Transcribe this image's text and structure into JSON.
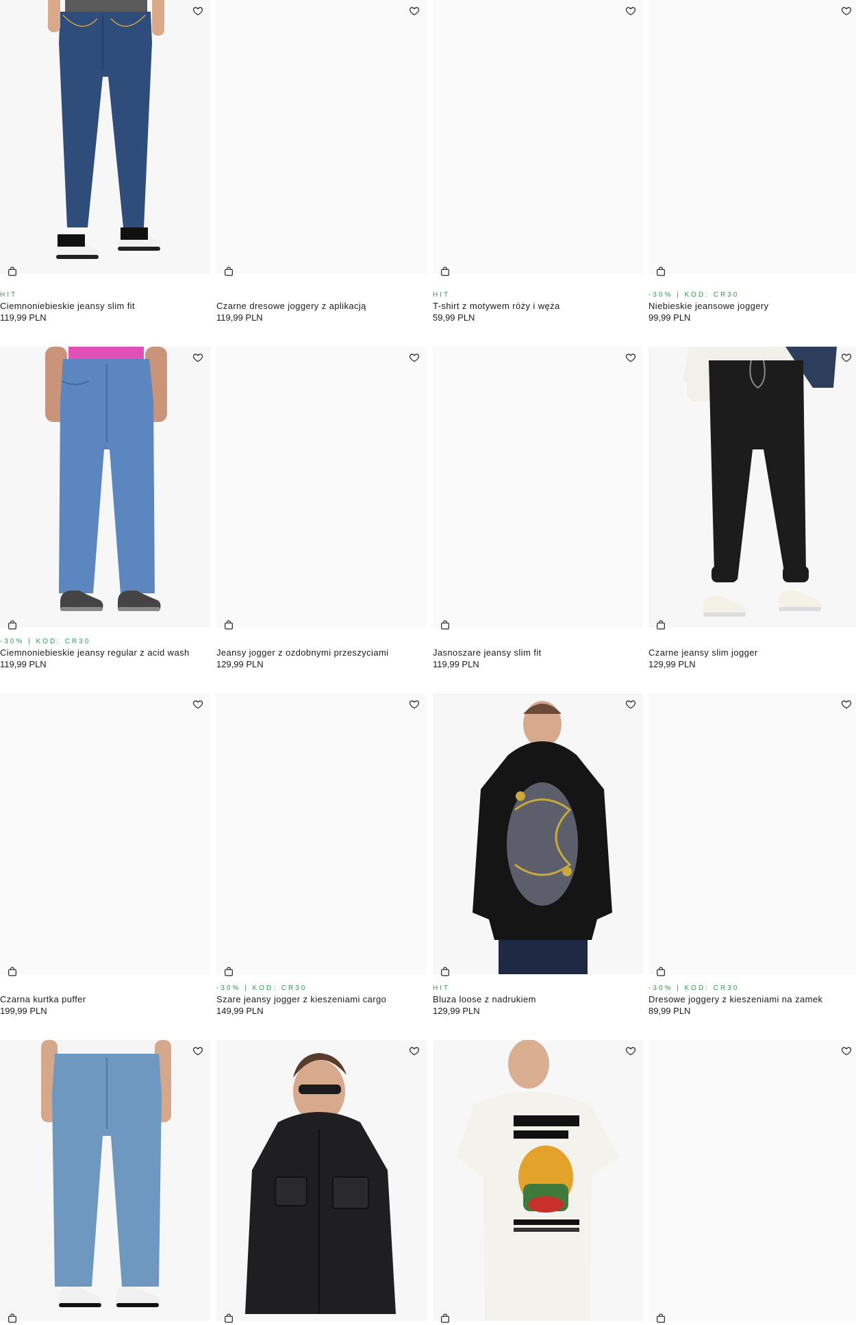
{
  "colors": {
    "badge": "#2e9a4e",
    "text": "#1a1a1a"
  },
  "icons": {
    "favorite": "heart-outline-icon",
    "cart": "shopping-bag-icon"
  },
  "products": [
    {
      "badge": "HIT",
      "name": "Ciemnoniebieskie jeansy slim fit",
      "price": "119,99 PLN",
      "image": "jeans-dark-blue-slim"
    },
    {
      "badge": "",
      "name": "Czarne dresowe joggery z aplikacją",
      "price": "119,99 PLN",
      "image": ""
    },
    {
      "badge": "HIT",
      "name": "T-shirt z motywem róży i węża",
      "price": "59,99 PLN",
      "image": ""
    },
    {
      "badge": "-30% | KOD: CR30",
      "name": "Niebieskie jeansowe joggery",
      "price": "99,99 PLN",
      "image": ""
    },
    {
      "badge": "-30% | KOD: CR30",
      "name": "Ciemnoniebieskie jeansy regular z acid wash",
      "price": "119,99 PLN",
      "image": "jeans-regular-acid"
    },
    {
      "badge": "",
      "name": "Jeansy jogger z ozdobnymi przeszyciami",
      "price": "129,99 PLN",
      "image": ""
    },
    {
      "badge": "",
      "name": "Jasnoszare jeansy slim fit",
      "price": "119,99 PLN",
      "image": ""
    },
    {
      "badge": "",
      "name": "Czarne jeansy slim jogger",
      "price": "129,99 PLN",
      "image": "black-jogger"
    },
    {
      "badge": "",
      "name": "Czarna kurtka puffer",
      "price": "199,99 PLN",
      "image": ""
    },
    {
      "badge": "-30% | KOD: CR30",
      "name": "Szare jeansy jogger z kieszeniami cargo",
      "price": "149,99 PLN",
      "image": ""
    },
    {
      "badge": "HIT",
      "name": "Bluza loose z nadrukiem",
      "price": "129,99 PLN",
      "image": "black-hoodie-dragon"
    },
    {
      "badge": "-30% | KOD: CR30",
      "name": "Dresowe joggery z kieszeniami na zamek",
      "price": "89,99 PLN",
      "image": ""
    },
    {
      "badge": "",
      "name": "",
      "price": "",
      "image": "jeans-light-wide"
    },
    {
      "badge": "",
      "name": "",
      "price": "",
      "image": "black-jacket"
    },
    {
      "badge": "",
      "name": "",
      "price": "",
      "image": "white-tshirt-print"
    },
    {
      "badge": "",
      "name": "",
      "price": "",
      "image": ""
    }
  ]
}
